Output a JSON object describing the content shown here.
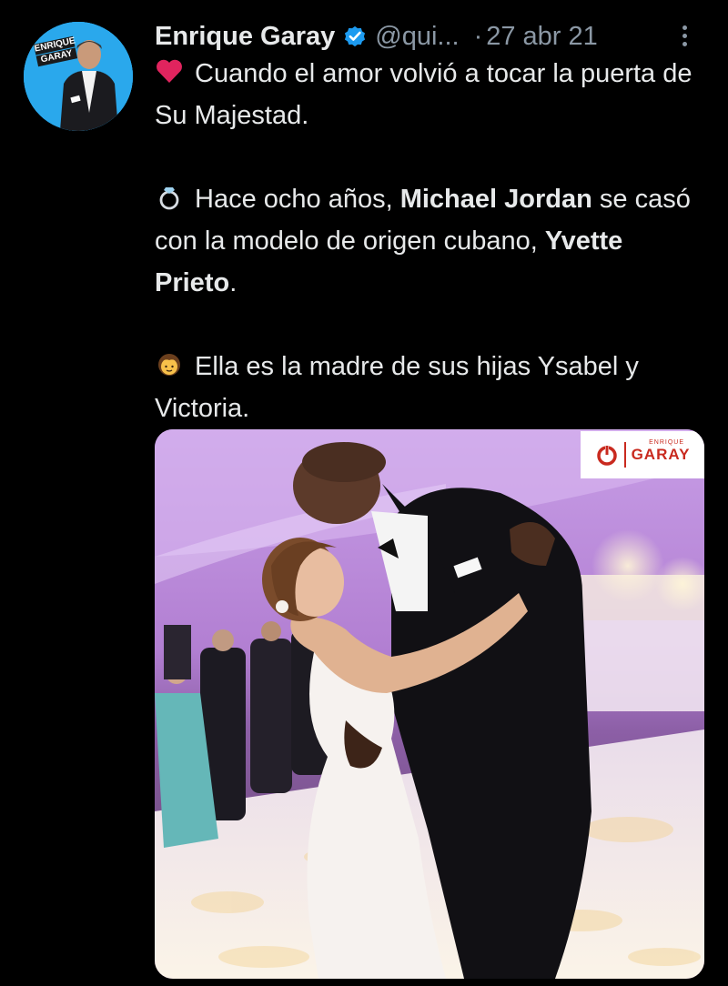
{
  "author": {
    "name": "Enrique Garay",
    "handle": "@qui...",
    "date_separator": "·",
    "date": "27 abr 21",
    "avatar_badge_line1": "ENRIQUE",
    "avatar_badge_line2": "GARAY",
    "verified_icon": "verified-badge-icon"
  },
  "tweet": {
    "p1": "Cuando el amor volvió a tocar la puerta de Su Majestad.",
    "p2_before": "Hace ocho años, ",
    "p2_bold1": "Michael Jordan",
    "p2_middle": " se casó con la modelo de origen cubano, ",
    "p2_bold2": "Yvette Prieto",
    "p2_after": ".",
    "p3": "Ella es la madre de sus hijas Ysabel y Victoria."
  },
  "media": {
    "watermark_small": "ENRIQUE",
    "watermark_main": "GARAY"
  },
  "colors": {
    "background": "#000000",
    "text": "#e7e9ea",
    "secondary": "#8b98a5",
    "verified": "#1d9bf0",
    "watermark_red": "#c92a1f"
  }
}
